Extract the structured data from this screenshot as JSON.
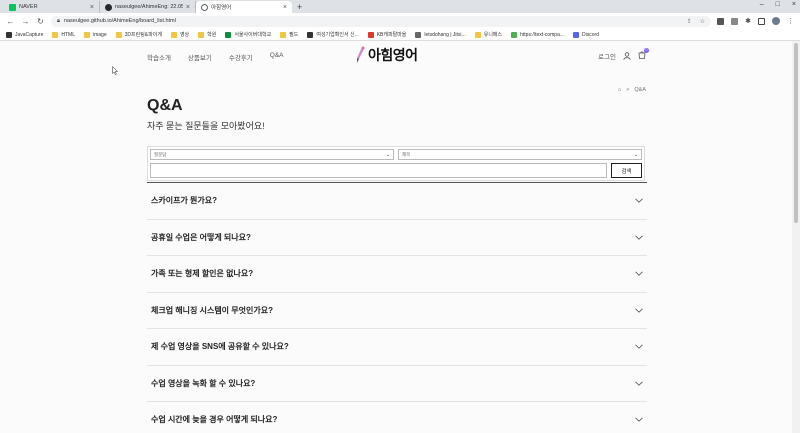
{
  "browser": {
    "tabs": [
      {
        "title": "NAVER",
        "color": "#03c75a"
      },
      {
        "title": "naseulgee/AhimeEng: 22.05.09",
        "color": "#24292f"
      },
      {
        "title": "아힘영어",
        "color": "#5f6368"
      }
    ],
    "new_tab": "+",
    "url": "naseulgee.github.io/AhimeEng/board_list.html",
    "bookmarks": [
      {
        "label": "JavaCapture",
        "color": "#333"
      },
      {
        "label": "HTML",
        "color": "#f4c542"
      },
      {
        "label": "image",
        "color": "#f4c542"
      },
      {
        "label": "3D프린팅&파이게",
        "color": "#f4c542"
      },
      {
        "label": "영상",
        "color": "#f4c542"
      },
      {
        "label": "학원",
        "color": "#f4c542"
      },
      {
        "label": "서울사이버대학교",
        "color": "#0a8f3c"
      },
      {
        "label": "필드",
        "color": "#f4c542"
      },
      {
        "label": "여성기업확인서 신...",
        "color": "#333"
      },
      {
        "label": "KB캐피탈마을",
        "color": "#e0392b"
      },
      {
        "label": "letsdohang | Jitsi...",
        "color": "#666"
      },
      {
        "label": "유니메스",
        "color": "#f4c542"
      },
      {
        "label": "https://text-compa...",
        "color": "#4caf50"
      },
      {
        "label": "Discord",
        "color": "#5865f2"
      }
    ]
  },
  "site": {
    "nav": [
      "학습소개",
      "상품보기",
      "수강후기",
      "Q&A"
    ],
    "logo_text": "아힘영어",
    "login": "로그인",
    "cart_count": "0",
    "accent": "#7a5cff"
  },
  "breadcrumb": {
    "home": "⌂",
    "sep": ">",
    "current": "Q&A"
  },
  "page": {
    "title": "Q&A",
    "subtitle": "자주 묻는 질문들을 모아봤어요!"
  },
  "search": {
    "select1": "질문답",
    "select2": "제목",
    "input_value": "",
    "button": "검색"
  },
  "faq": [
    "스카이프가 뭔가요?",
    "공휴일 수업은 어떻게 되나요?",
    "가족 또는 형제 할인은 없나요?",
    "체크업 해니징 시스템이 무엇인가요?",
    "제 수업 영상을 SNS에 공유할 수 있나요?",
    "수업 영상을 녹화 할 수 있나요?",
    "수업 시간에 늦을 경우 어떻게 되나요?"
  ]
}
